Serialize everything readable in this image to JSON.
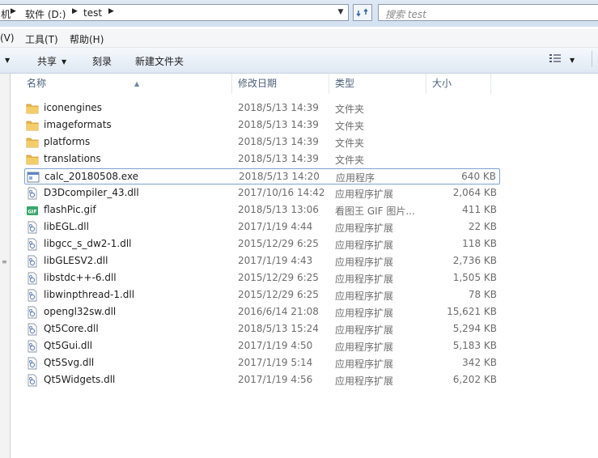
{
  "address_bar": {
    "crumbs": [
      "机",
      "软件 (D:)",
      "test"
    ],
    "search_placeholder": "搜索 test"
  },
  "menu": {
    "items": [
      "(V)",
      "工具(T)",
      "帮助(H)"
    ]
  },
  "toolbar": {
    "share": "共享",
    "burn": "刻录",
    "new_folder": "新建文件夹"
  },
  "columns": {
    "name": "名称",
    "date": "修改日期",
    "type": "类型",
    "size": "大小"
  },
  "files": [
    {
      "name": "iconengines",
      "date": "2018/5/13 14:39",
      "type": "文件夹",
      "size": "",
      "icon": "folder-icon"
    },
    {
      "name": "imageformats",
      "date": "2018/5/13 14:39",
      "type": "文件夹",
      "size": "",
      "icon": "folder-icon"
    },
    {
      "name": "platforms",
      "date": "2018/5/13 14:39",
      "type": "文件夹",
      "size": "",
      "icon": "folder-icon"
    },
    {
      "name": "translations",
      "date": "2018/5/13 14:39",
      "type": "文件夹",
      "size": "",
      "icon": "folder-icon"
    },
    {
      "name": "calc_20180508.exe",
      "date": "2018/5/13 14:20",
      "type": "应用程序",
      "size": "640 KB",
      "icon": "exe-icon",
      "selected": true
    },
    {
      "name": "D3Dcompiler_43.dll",
      "date": "2017/10/16 14:42",
      "type": "应用程序扩展",
      "size": "2,064 KB",
      "icon": "dll-icon"
    },
    {
      "name": "flashPic.gif",
      "date": "2018/5/13 13:06",
      "type": "看图王 GIF 图片...",
      "size": "411 KB",
      "icon": "gif-icon"
    },
    {
      "name": "libEGL.dll",
      "date": "2017/1/19 4:44",
      "type": "应用程序扩展",
      "size": "22 KB",
      "icon": "dll-icon"
    },
    {
      "name": "libgcc_s_dw2-1.dll",
      "date": "2015/12/29 6:25",
      "type": "应用程序扩展",
      "size": "118 KB",
      "icon": "dll-icon"
    },
    {
      "name": "libGLESV2.dll",
      "date": "2017/1/19 4:43",
      "type": "应用程序扩展",
      "size": "2,736 KB",
      "icon": "dll-icon"
    },
    {
      "name": "libstdc++-6.dll",
      "date": "2015/12/29 6:25",
      "type": "应用程序扩展",
      "size": "1,505 KB",
      "icon": "dll-icon"
    },
    {
      "name": "libwinpthread-1.dll",
      "date": "2015/12/29 6:25",
      "type": "应用程序扩展",
      "size": "78 KB",
      "icon": "dll-icon"
    },
    {
      "name": "opengl32sw.dll",
      "date": "2016/6/14 21:08",
      "type": "应用程序扩展",
      "size": "15,621 KB",
      "icon": "dll-icon"
    },
    {
      "name": "Qt5Core.dll",
      "date": "2018/5/13 15:24",
      "type": "应用程序扩展",
      "size": "5,294 KB",
      "icon": "dll-icon"
    },
    {
      "name": "Qt5Gui.dll",
      "date": "2017/1/19 4:50",
      "type": "应用程序扩展",
      "size": "5,183 KB",
      "icon": "dll-icon"
    },
    {
      "name": "Qt5Svg.dll",
      "date": "2017/1/19 5:14",
      "type": "应用程序扩展",
      "size": "342 KB",
      "icon": "dll-icon"
    },
    {
      "name": "Qt5Widgets.dll",
      "date": "2017/1/19 4:56",
      "type": "应用程序扩展",
      "size": "6,202 KB",
      "icon": "dll-icon"
    }
  ],
  "colors": {
    "folder": "#e8b84a",
    "selection_border": "#7da2ce",
    "header_text": "#4c607a"
  }
}
